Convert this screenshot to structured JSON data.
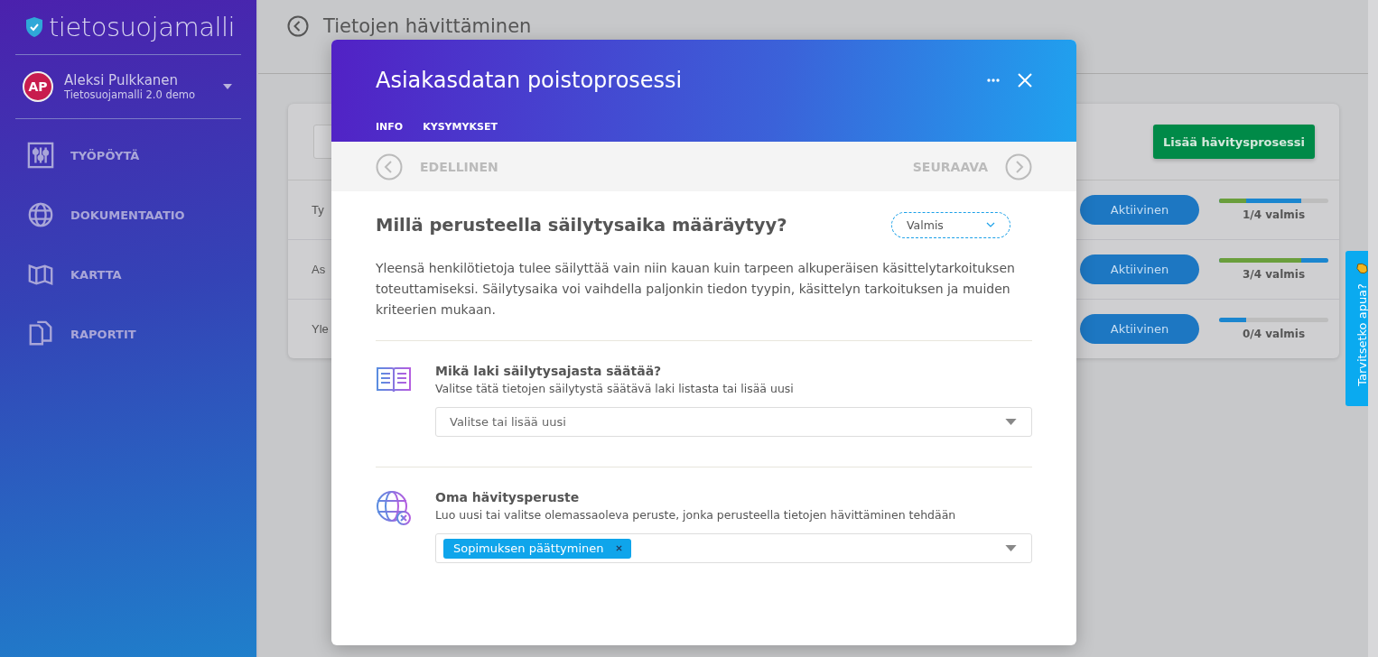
{
  "brand": {
    "name": "tietosuojamalli"
  },
  "user": {
    "initials": "AP",
    "name": "Aleksi Pulkkanen",
    "org": "Tietosuojamalli 2.0 demo"
  },
  "sidebar": {
    "items": [
      {
        "label": "TYÖPÖYTÄ"
      },
      {
        "label": "DOKUMENTAATIO"
      },
      {
        "label": "KARTTA"
      },
      {
        "label": "RAPORTIT"
      }
    ]
  },
  "page": {
    "title": "Tietojen hävittäminen",
    "add_button": "Lisää hävitysprosessi",
    "rows": [
      {
        "name": "Ty",
        "status": "Aktiivinen",
        "progress": "1/4 valmis",
        "segments": [
          {
            "color": "#6a9e3c",
            "level": 0.25
          },
          {
            "color": "#1b86cf",
            "level": 0.75
          }
        ]
      },
      {
        "name": "As",
        "status": "Aktiivinen",
        "progress": "3/4 valmis",
        "segments": [
          {
            "color": "#6a9e3c",
            "level": 0.75
          },
          {
            "color": "#1b86cf",
            "level": 1
          }
        ]
      },
      {
        "name": "Yle",
        "status": "Aktiivinen",
        "progress": "0/4 valmis",
        "segments": [
          {
            "color": "#1b86cf",
            "level": 0.25
          }
        ]
      }
    ]
  },
  "modal": {
    "title": "Asiakasdatan poistoprosessi",
    "tabs": [
      "INFO",
      "KYSYMYKSET"
    ],
    "prev": "EDELLINEN",
    "next": "SEURAAVA",
    "question": "Millä perusteella säilytysaika määräytyy?",
    "status": "Valmis",
    "description": "Yleensä henkilötietoja tulee säilyttää vain niin kauan kuin tarpeen alkuperäisen käsittelytarkoituksen toteuttamiseksi. Säilytysaika voi vaihdella paljonkin tiedon tyypin, käsittelyn tarkoituksen ja muiden kriteerien mukaan.",
    "sections": [
      {
        "title": "Mikä laki säilytysajasta säätää?",
        "hint": "Valitse tätä tietojen säilytystä säätävä laki listasta tai lisää uusi",
        "placeholder": "Valitse tai lisää uusi"
      },
      {
        "title": "Oma hävitysperuste",
        "hint": "Luo uusi tai valitse olemassaoleva peruste, jonka perusteella tietojen hävittäminen tehdään",
        "tags": [
          "Sopimuksen päättyminen"
        ]
      }
    ]
  },
  "help": {
    "label": "Tarvitsetko apua?"
  }
}
